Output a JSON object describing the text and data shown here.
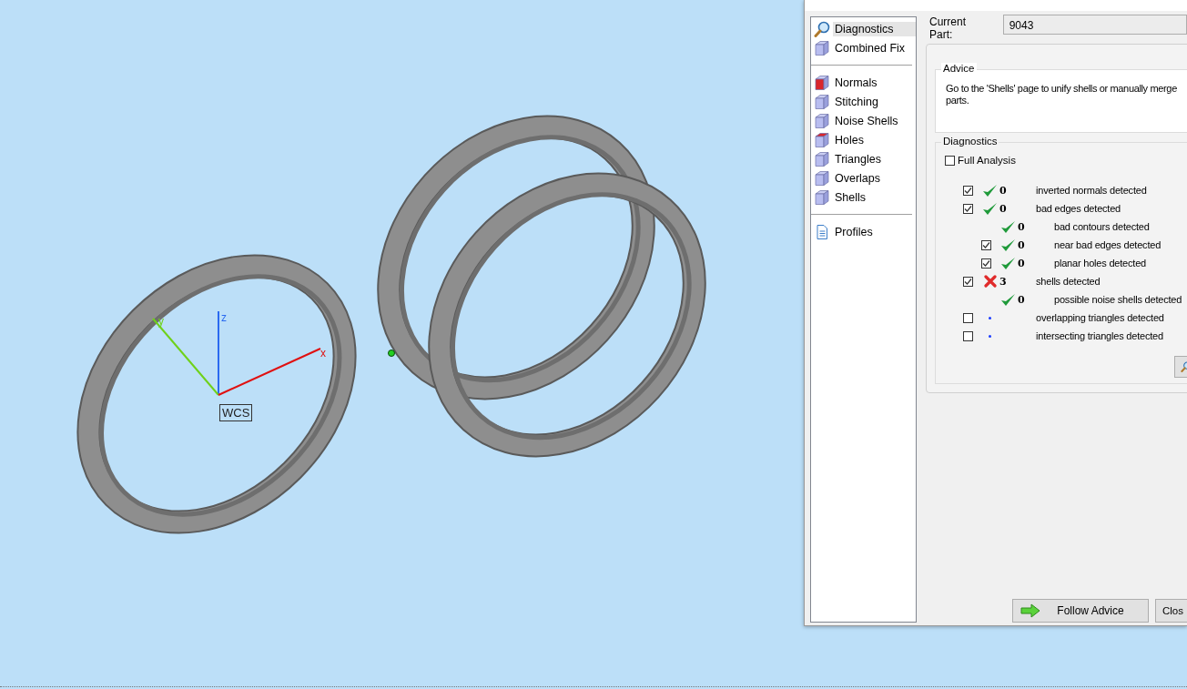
{
  "viewport": {
    "axes": [
      {
        "label": "z"
      },
      {
        "label": "y"
      },
      {
        "label": "x"
      }
    ],
    "wcs_label": "WCS"
  },
  "sidebar": {
    "groups": [
      [
        {
          "label": "Diagnostics",
          "selected": true
        },
        {
          "label": "Combined Fix",
          "selected": false
        }
      ],
      [
        {
          "label": "Normals",
          "selected": false
        },
        {
          "label": "Stitching",
          "selected": false
        },
        {
          "label": "Noise Shells",
          "selected": false
        },
        {
          "label": "Holes",
          "selected": false
        },
        {
          "label": "Triangles",
          "selected": false
        },
        {
          "label": "Overlaps",
          "selected": false
        },
        {
          "label": "Shells",
          "selected": false
        }
      ],
      [
        {
          "label": "Profiles",
          "selected": false
        }
      ]
    ]
  },
  "current_part": {
    "label": "Current Part:",
    "value": "9043"
  },
  "advice": {
    "title": "Advice",
    "text": "Go to the 'Shells' page to unify shells or manually merge parts."
  },
  "diagnostics": {
    "title": "Diagnostics",
    "full_analysis": {
      "label": "Full Analysis",
      "checked": false
    },
    "rows": [
      {
        "checked": true,
        "kind": "ok",
        "count": "0",
        "label": "inverted normals detected"
      },
      {
        "checked": true,
        "kind": "ok",
        "count": "0",
        "label": "bad edges detected",
        "children": [
          {
            "kind": "ok",
            "count": "0",
            "label": "bad contours detected"
          },
          {
            "checked": true,
            "kind": "ok",
            "count": "0",
            "label": "near bad edges detected"
          },
          {
            "checked": true,
            "kind": "ok",
            "count": "0",
            "label": "planar holes detected"
          }
        ]
      },
      {
        "checked": true,
        "kind": "fail",
        "count": "3",
        "label": "shells detected",
        "children": [
          {
            "kind": "ok",
            "count": "0",
            "label": "possible noise shells detected"
          }
        ]
      },
      {
        "checked": false,
        "kind": "unknown",
        "label": "overlapping triangles detected"
      },
      {
        "checked": false,
        "kind": "unknown",
        "label": "intersecting triangles detected"
      }
    ]
  },
  "buttons": [
    {
      "kind": "follow",
      "label": "Follow Advice"
    },
    {
      "kind": "plain",
      "label": "Clos"
    }
  ]
}
